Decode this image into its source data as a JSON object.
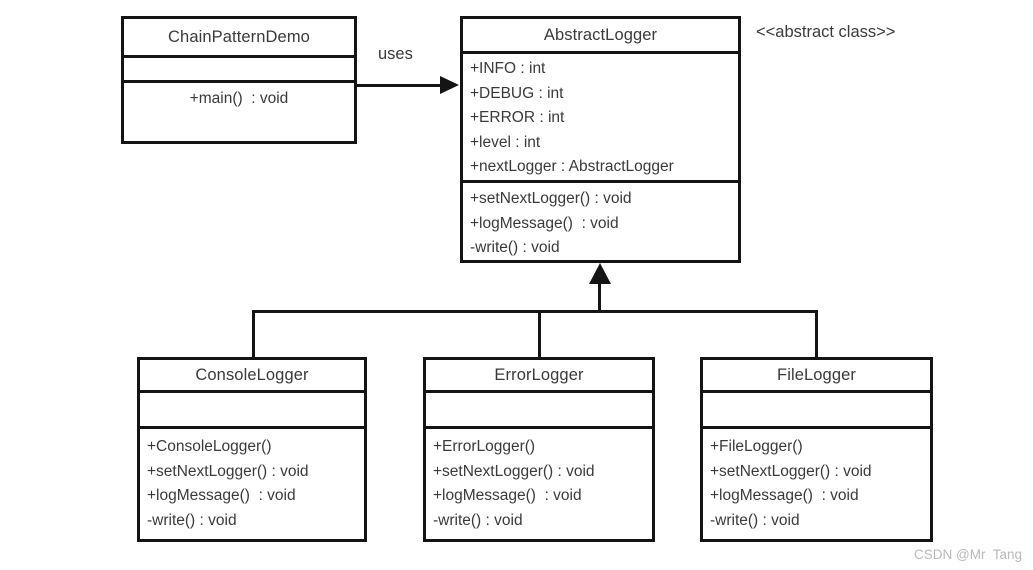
{
  "diagram": {
    "title": "Chain of Responsibility UML class diagram",
    "background_color": "#ffffff",
    "line_color": "#141414",
    "text_color": "#3a3a3a"
  },
  "classes": {
    "demo": {
      "name": "ChainPatternDemo",
      "attributes": [],
      "operations": [
        "+main()  : void"
      ]
    },
    "abstract_logger": {
      "name": "AbstractLogger",
      "stereotype": "<<abstract class>>",
      "attributes": [
        "+INFO : int",
        "+DEBUG : int",
        "+ERROR : int",
        "+level : int",
        "+nextLogger : AbstractLogger"
      ],
      "operations": [
        "+setNextLogger() : void",
        "+logMessage()  : void",
        "-write() : void"
      ]
    },
    "console_logger": {
      "name": "ConsoleLogger",
      "attributes": [],
      "operations": [
        "+ConsoleLogger()",
        "+setNextLogger() : void",
        "+logMessage()  : void",
        "-write() : void"
      ]
    },
    "error_logger": {
      "name": "ErrorLogger",
      "attributes": [],
      "operations": [
        "+ErrorLogger()",
        "+setNextLogger() : void",
        "+logMessage()  : void",
        "-write() : void"
      ]
    },
    "file_logger": {
      "name": "FileLogger",
      "attributes": [],
      "operations": [
        "+FileLogger()",
        "+setNextLogger() : void",
        "+logMessage()  : void",
        "-write() : void"
      ]
    }
  },
  "relations": {
    "uses_label": "uses"
  },
  "watermark": {
    "text": "CSDN @Mr  Tang"
  }
}
